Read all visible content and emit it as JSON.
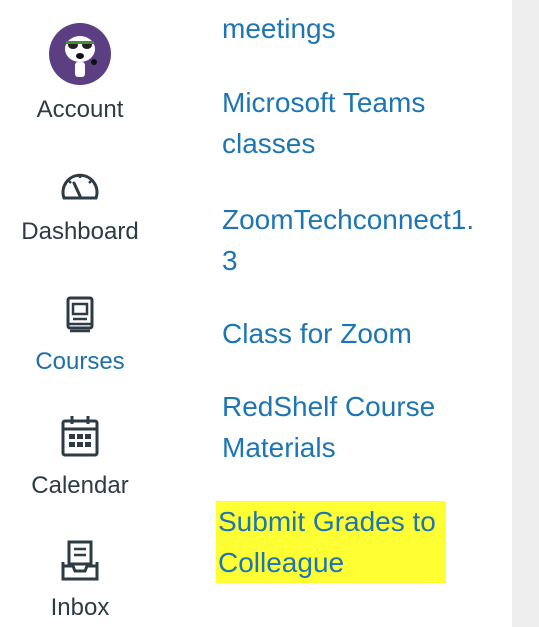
{
  "nav": {
    "account": {
      "label": "Account"
    },
    "dashboard": {
      "label": "Dashboard"
    },
    "courses": {
      "label": "Courses"
    },
    "calendar": {
      "label": "Calendar"
    },
    "inbox": {
      "label": "Inbox"
    }
  },
  "courses": {
    "items": [
      {
        "line1": "meetings",
        "line2": ""
      },
      {
        "line1": "Microsoft Teams",
        "line2": "classes"
      },
      {
        "line1": "ZoomTechconnect1.",
        "line2": "3"
      },
      {
        "line1": "Class for Zoom",
        "line2": ""
      },
      {
        "line1": "RedShelf Course",
        "line2": "Materials"
      },
      {
        "line1": "Submit Grades to",
        "line2": "Colleague"
      }
    ]
  },
  "colors": {
    "link": "#1d75b3",
    "highlight": "#ffff33",
    "nav_text": "#2d3b45",
    "nav_active": "#1f6fa8",
    "panel": "#eeeeee"
  }
}
